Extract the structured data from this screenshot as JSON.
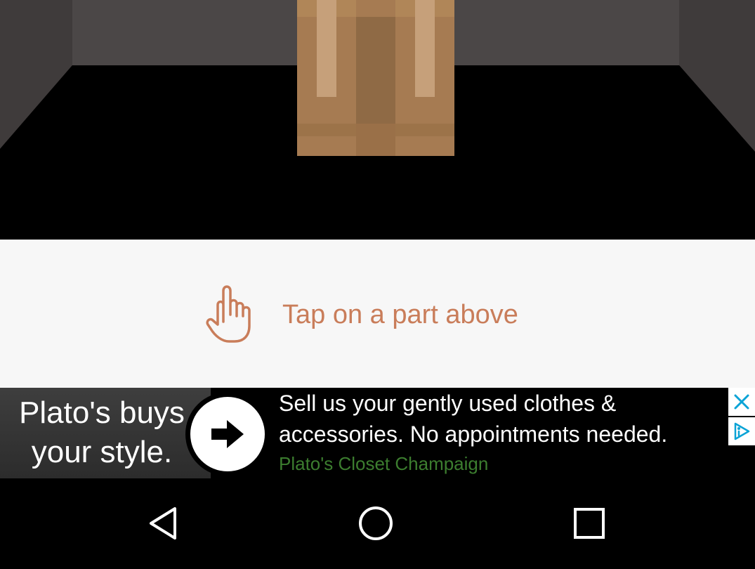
{
  "hint": {
    "icon": "pointing-hand-icon",
    "text": "Tap on a part above"
  },
  "ad": {
    "headline": "Plato's buys\nyour style.",
    "body": "Sell us your gently used clothes &\naccessories. No appointments needed.",
    "advertiser": "Plato's Closet Champaign",
    "icons": [
      "arrow-right-icon",
      "close-icon",
      "adchoices-icon"
    ]
  },
  "navigation": {
    "buttons": [
      "back-icon",
      "home-icon",
      "recents-icon"
    ]
  },
  "colors": {
    "hint_accent": "#c97d5a",
    "panel_bg": "#f7f7f7",
    "advertiser_text": "#3c7d2f",
    "skin_tone": "#a67b52"
  }
}
